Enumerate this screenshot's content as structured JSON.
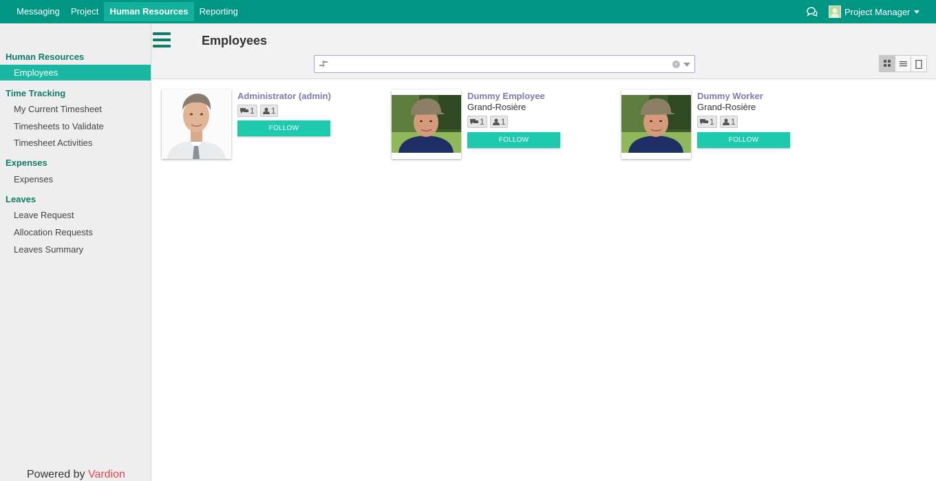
{
  "topnav": {
    "items": [
      "Messaging",
      "Project",
      "Human Resources",
      "Reporting"
    ],
    "active": "Human Resources",
    "user_name": "Project Manager",
    "chat_icon": "chat-bubbles-icon",
    "colors": {
      "bar": "#009684",
      "active": "#13b19c"
    }
  },
  "sidebar": {
    "sections": [
      {
        "title": "Human Resources",
        "items": [
          "Employees"
        ]
      },
      {
        "title": "Time Tracking",
        "items": [
          "My Current Timesheet",
          "Timesheets to Validate",
          "Timesheet Activities"
        ]
      },
      {
        "title": "Expenses",
        "items": [
          "Expenses"
        ]
      },
      {
        "title": "Leaves",
        "items": [
          "Leave Request",
          "Allocation Requests",
          "Leaves Summary"
        ]
      }
    ],
    "active_item": "Employees",
    "powered_by": "Powered by",
    "brand": "Vardion"
  },
  "panel": {
    "title": "Employees",
    "search_value": "",
    "views": [
      "kanban-view-icon",
      "list-view-icon",
      "form-view-icon"
    ],
    "active_view": "kanban-view-icon"
  },
  "employees": [
    {
      "name": "Administrator (admin)",
      "location": "",
      "messages": "1",
      "followers": "1",
      "follow_label": "FOLLOW",
      "photo": "man-in-suit-photo"
    },
    {
      "name": "Dummy Employee",
      "location": "Grand-Rosière",
      "messages": "1",
      "followers": "1",
      "follow_label": "FOLLOW",
      "photo": "man-with-cap-photo"
    },
    {
      "name": "Dummy Worker",
      "location": "Grand-Rosière",
      "messages": "1",
      "followers": "1",
      "follow_label": "FOLLOW",
      "photo": "man-with-cap-photo"
    }
  ]
}
